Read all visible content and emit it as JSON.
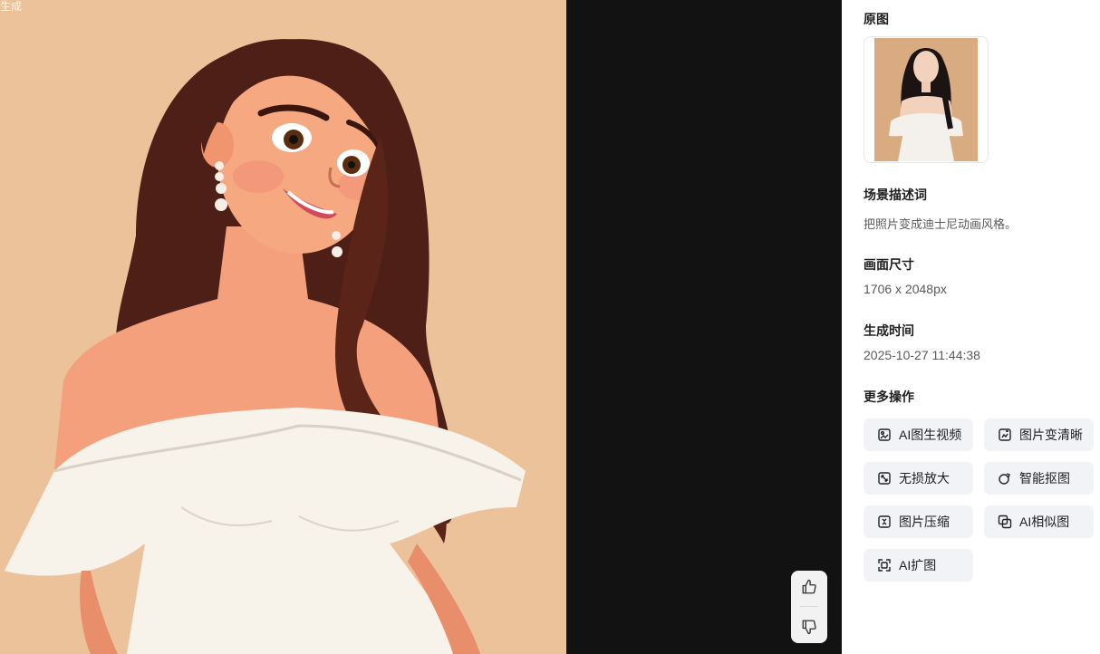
{
  "result_badge": "生成",
  "sidebar": {
    "original_title": "原图",
    "prompt_title": "场景描述词",
    "prompt_text": "把照片变成迪士尼动画风格。",
    "size_title": "画面尺寸",
    "size_value": "1706 x 2048px",
    "time_title": "生成时间",
    "time_value": "2025-10-27 11:44:38",
    "more_title": "更多操作",
    "actions": [
      {
        "label": "AI图生视频",
        "icon": "image-video-icon"
      },
      {
        "label": "图片变清晰",
        "icon": "image-sharpen-icon"
      },
      {
        "label": "无损放大",
        "icon": "upscale-icon"
      },
      {
        "label": "智能抠图",
        "icon": "cutout-icon"
      },
      {
        "label": "图片压缩",
        "icon": "compress-icon"
      },
      {
        "label": "AI相似图",
        "icon": "similar-image-icon"
      },
      {
        "label": "AI扩图",
        "icon": "expand-image-icon"
      }
    ]
  },
  "feedback": {
    "like_icon": "thumbs-up-icon",
    "dislike_icon": "thumbs-down-icon"
  },
  "colors": {
    "stage_bg": "#121212",
    "result_bg": "#efc9a4",
    "panel_bg": "#ffffff",
    "action_bg": "#f1f3f7"
  }
}
